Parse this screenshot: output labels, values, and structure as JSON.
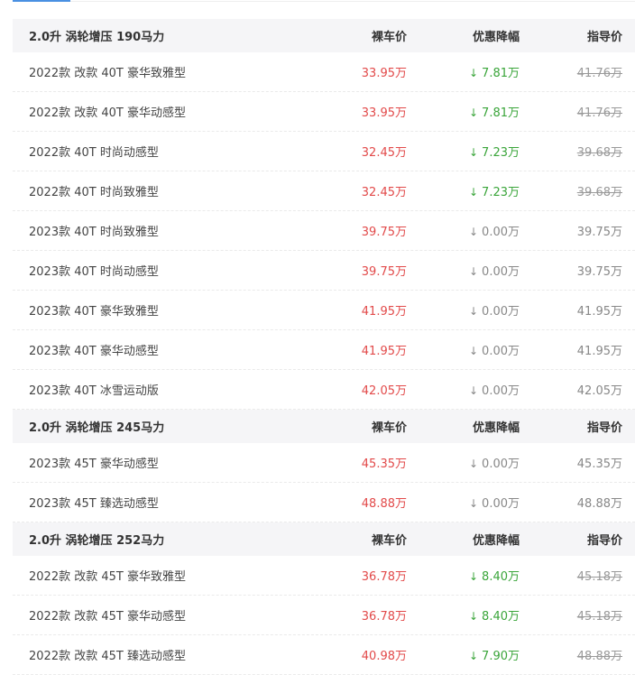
{
  "colors": {
    "price": "#e24a4a",
    "discount_positive": "#3aa53a",
    "discount_zero": "#888888",
    "header_bg": "#f5f5f7",
    "tab_accent": "#4a90e2"
  },
  "groups": [
    {
      "title": "2.0升 涡轮增压 190马力",
      "col_price": "裸车价",
      "col_discount": "优惠降幅",
      "col_guide": "指导价",
      "rows": [
        {
          "name": "2022款 改款 40T 豪华致雅型",
          "price": "33.95万",
          "discount": "7.81万",
          "discount_type": "positive",
          "guide": "41.76万",
          "guide_strike": true
        },
        {
          "name": "2022款 改款 40T 豪华动感型",
          "price": "33.95万",
          "discount": "7.81万",
          "discount_type": "positive",
          "guide": "41.76万",
          "guide_strike": true
        },
        {
          "name": "2022款 40T 时尚动感型",
          "price": "32.45万",
          "discount": "7.23万",
          "discount_type": "positive",
          "guide": "39.68万",
          "guide_strike": true
        },
        {
          "name": "2022款 40T 时尚致雅型",
          "price": "32.45万",
          "discount": "7.23万",
          "discount_type": "positive",
          "guide": "39.68万",
          "guide_strike": true
        },
        {
          "name": "2023款 40T 时尚致雅型",
          "price": "39.75万",
          "discount": "0.00万",
          "discount_type": "zero",
          "guide": "39.75万",
          "guide_strike": false
        },
        {
          "name": "2023款 40T 时尚动感型",
          "price": "39.75万",
          "discount": "0.00万",
          "discount_type": "zero",
          "guide": "39.75万",
          "guide_strike": false
        },
        {
          "name": "2023款 40T 豪华致雅型",
          "price": "41.95万",
          "discount": "0.00万",
          "discount_type": "zero",
          "guide": "41.95万",
          "guide_strike": false
        },
        {
          "name": "2023款 40T 豪华动感型",
          "price": "41.95万",
          "discount": "0.00万",
          "discount_type": "zero",
          "guide": "41.95万",
          "guide_strike": false
        },
        {
          "name": "2023款 40T 冰雪运动版",
          "price": "42.05万",
          "discount": "0.00万",
          "discount_type": "zero",
          "guide": "42.05万",
          "guide_strike": false
        }
      ]
    },
    {
      "title": "2.0升 涡轮增压 245马力",
      "col_price": "裸车价",
      "col_discount": "优惠降幅",
      "col_guide": "指导价",
      "rows": [
        {
          "name": "2023款 45T 豪华动感型",
          "price": "45.35万",
          "discount": "0.00万",
          "discount_type": "zero",
          "guide": "45.35万",
          "guide_strike": false
        },
        {
          "name": "2023款 45T 臻选动感型",
          "price": "48.88万",
          "discount": "0.00万",
          "discount_type": "zero",
          "guide": "48.88万",
          "guide_strike": false
        }
      ]
    },
    {
      "title": "2.0升 涡轮增压 252马力",
      "col_price": "裸车价",
      "col_discount": "优惠降幅",
      "col_guide": "指导价",
      "rows": [
        {
          "name": "2022款 改款 45T 豪华致雅型",
          "price": "36.78万",
          "discount": "8.40万",
          "discount_type": "positive",
          "guide": "45.18万",
          "guide_strike": true
        },
        {
          "name": "2022款 改款 45T 豪华动感型",
          "price": "36.78万",
          "discount": "8.40万",
          "discount_type": "positive",
          "guide": "45.18万",
          "guide_strike": true
        },
        {
          "name": "2022款 改款 45T 臻选动感型",
          "price": "40.98万",
          "discount": "7.90万",
          "discount_type": "positive",
          "guide": "48.88万",
          "guide_strike": true
        }
      ]
    }
  ]
}
